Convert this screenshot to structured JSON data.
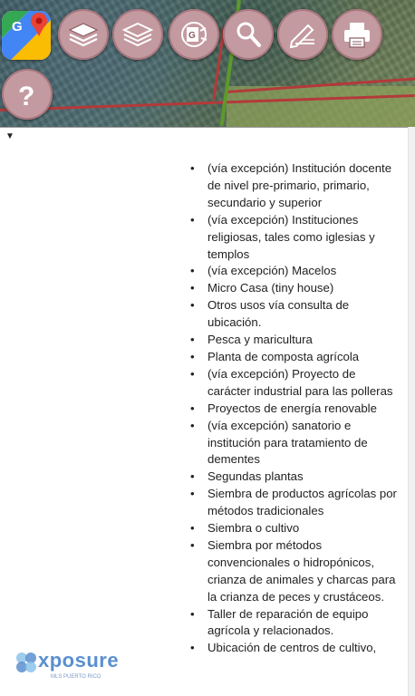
{
  "toolbar": {
    "tools": [
      {
        "name": "google-maps",
        "icon": "google-maps-icon"
      },
      {
        "name": "layers",
        "icon": "layers-icon"
      },
      {
        "name": "base-layers",
        "icon": "layers-outline-icon"
      },
      {
        "name": "gps",
        "icon": "gps-map-icon"
      },
      {
        "name": "search",
        "icon": "search-icon"
      },
      {
        "name": "edit",
        "icon": "pencil-ruler-icon"
      },
      {
        "name": "print",
        "icon": "printer-icon"
      },
      {
        "name": "help",
        "icon": "question-icon"
      }
    ],
    "button_color": "#c39aa0"
  },
  "dropdown": {
    "caret": "▼"
  },
  "uses_list": [
    "(vía excepción) Institución docente de nivel pre-primario, primario, secundario y superior",
    "(vía excepción) Instituciones religiosas, tales como iglesias y templos",
    "(vía excepción) Macelos",
    "Micro Casa (tiny house)",
    "Otros usos vía consulta de ubicación.",
    "Pesca y maricultura",
    "Planta de composta agrícola",
    "(vía excepción) Proyecto de carácter industrial para las polleras",
    "Proyectos de energía renovable",
    "(vía excepción) sanatorio e institución para tratamiento de dementes",
    "Segundas plantas",
    "Siembra de productos agrícolas por métodos tradicionales",
    "Siembra o cultivo",
    "Siembra por métodos convencionales o hidropónicos, crianza de animales y charcas para la crianza de peces y crustáceos.",
    "Taller de reparación de equipo agrícola y relacionados.",
    "Ubicación de centros de cultivo,"
  ],
  "watermark": {
    "brand": "xposure",
    "sub": "MLS PUERTO RICO"
  }
}
